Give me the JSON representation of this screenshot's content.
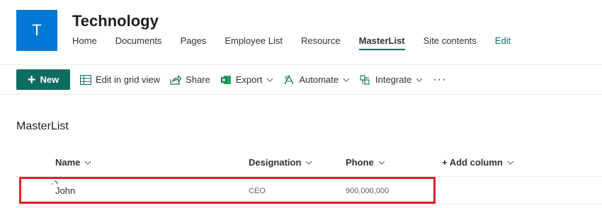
{
  "site": {
    "logo_letter": "T",
    "title": "Technology",
    "nav": [
      "Home",
      "Documents",
      "Pages",
      "Employee List",
      "Resource",
      "MasterList",
      "Site contents",
      "Edit"
    ],
    "active_nav": "MasterList"
  },
  "commandbar": {
    "new_label": "New",
    "edit_grid_label": "Edit in grid view",
    "share_label": "Share",
    "export_label": "Export",
    "automate_label": "Automate",
    "integrate_label": "Integrate",
    "more_label": "···"
  },
  "list": {
    "title": "MasterList",
    "columns": {
      "name": "Name",
      "designation": "Designation",
      "phone": "Phone",
      "add_column": "+ Add column"
    },
    "rows": [
      {
        "name": "John",
        "designation": "CEO",
        "phone": "900,000,000"
      }
    ]
  },
  "colors": {
    "accent": "#0f6c61",
    "logo_bg": "#0078d4",
    "highlight": "#e0212b"
  }
}
